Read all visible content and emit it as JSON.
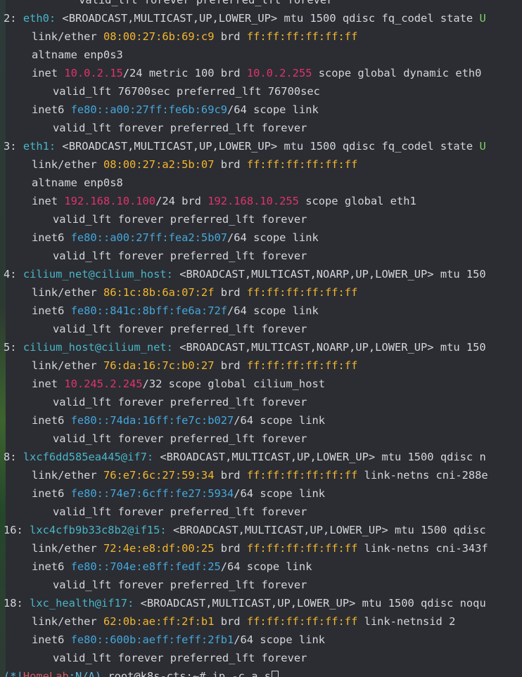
{
  "terminal": {
    "lines": [
      {
        "t": "    valid_lft forever preferred_lft forever"
      },
      {
        "n": "2: ",
        "iface": "eth0:",
        "flags": " <BROADCAST,MULTICAST,UP,LOWER_UP> mtu 1500 qdisc fq_codel state ",
        "tail": "U"
      },
      {
        "a": "link/ether ",
        "mac": "08:00:27:6b:69:c9",
        "b": " brd ",
        "brd": "ff:ff:ff:ff:ff:ff"
      },
      {
        "t": "altname enp0s3"
      },
      {
        "a": "inet ",
        "ip": "10.0.2.15",
        "b": "/24 metric 100 brd ",
        "brd": "10.0.2.255",
        "c": " scope global dynamic eth0"
      },
      {
        "t": "valid_lft 76700sec preferred_lft 76700sec"
      },
      {
        "a": "inet6 ",
        "ip": "fe80::a00:27ff:fe6b:69c9",
        "b": "/64 scope link"
      },
      {
        "t": "valid_lft forever preferred_lft forever"
      },
      {
        "n": "3: ",
        "iface": "eth1:",
        "flags": " <BROADCAST,MULTICAST,UP,LOWER_UP> mtu 1500 qdisc fq_codel state ",
        "tail": "U"
      },
      {
        "a": "link/ether ",
        "mac": "08:00:27:a2:5b:07",
        "b": " brd ",
        "brd": "ff:ff:ff:ff:ff:ff"
      },
      {
        "t": "altname enp0s8"
      },
      {
        "a": "inet ",
        "ip": "192.168.10.100",
        "b": "/24 brd ",
        "brd": "192.168.10.255",
        "c": " scope global eth1"
      },
      {
        "t": "valid_lft forever preferred_lft forever"
      },
      {
        "a": "inet6 ",
        "ip": "fe80::a00:27ff:fea2:5b07",
        "b": "/64 scope link"
      },
      {
        "t": "valid_lft forever preferred_lft forever"
      },
      {
        "n": "4: ",
        "iface": "cilium_net@cilium_host:",
        "flags": " <BROADCAST,MULTICAST,NOARP,UP,LOWER_UP> mtu 150"
      },
      {
        "a": "link/ether ",
        "mac": "86:1c:8b:6a:07:2f",
        "b": " brd ",
        "brd": "ff:ff:ff:ff:ff:ff"
      },
      {
        "a": "inet6 ",
        "ip": "fe80::841c:8bff:fe6a:72f",
        "b": "/64 scope link"
      },
      {
        "t": "valid_lft forever preferred_lft forever"
      },
      {
        "n": "5: ",
        "iface": "cilium_host@cilium_net:",
        "flags": " <BROADCAST,MULTICAST,NOARP,UP,LOWER_UP> mtu 150"
      },
      {
        "a": "link/ether ",
        "mac": "76:da:16:7c:b0:27",
        "b": " brd ",
        "brd": "ff:ff:ff:ff:ff:ff"
      },
      {
        "a": "inet ",
        "ip": "10.245.2.245",
        "b": "/32 scope global cilium_host"
      },
      {
        "t": "valid_lft forever preferred_lft forever"
      },
      {
        "a": "inet6 ",
        "ip": "fe80::74da:16ff:fe7c:b027",
        "b": "/64 scope link"
      },
      {
        "t": "valid_lft forever preferred_lft forever"
      },
      {
        "n": "8: ",
        "iface": "lxcf6dd585ea445@if7:",
        "flags": " <BROADCAST,MULTICAST,UP,LOWER_UP> mtu 1500 qdisc n"
      },
      {
        "a": "link/ether ",
        "mac": "76:e7:6c:27:59:34",
        "b": " brd ",
        "brd": "ff:ff:ff:ff:ff:ff",
        "c": " link-netns cni-288e"
      },
      {
        "a": "inet6 ",
        "ip": "fe80::74e7:6cff:fe27:5934",
        "b": "/64 scope link"
      },
      {
        "t": "valid_lft forever preferred_lft forever"
      },
      {
        "n": "16: ",
        "iface": "lxc4cfb9b33c8b2@if15:",
        "flags": " <BROADCAST,MULTICAST,UP,LOWER_UP> mtu 1500 qdisc"
      },
      {
        "a": "link/ether ",
        "mac": "72:4e:e8:df:00:25",
        "b": " brd ",
        "brd": "ff:ff:ff:ff:ff:ff",
        "c": " link-netns cni-343f"
      },
      {
        "a": "inet6 ",
        "ip": "fe80::704e:e8ff:fedf:25",
        "b": "/64 scope link"
      },
      {
        "t": "valid_lft forever preferred_lft forever"
      },
      {
        "n": "18: ",
        "iface": "lxc_health@if17:",
        "flags": " <BROADCAST,MULTICAST,UP,LOWER_UP> mtu 1500 qdisc noqu"
      },
      {
        "a": "link/ether ",
        "mac": "62:0b:ae:ff:2f:b1",
        "b": " brd ",
        "brd": "ff:ff:ff:ff:ff:ff",
        "c": " link-netnsid 2"
      },
      {
        "a": "inet6 ",
        "ip": "fe80::600b:aeff:feff:2fb1",
        "b": "/64 scope link"
      },
      {
        "t": "valid_lft forever preferred_lft forever"
      }
    ],
    "prompt": {
      "open": "(",
      "star": "*",
      "sep": "|",
      "host": "HomeLab",
      "colon": ":",
      "ns": "N/A",
      "close": ")",
      "rest": " root@k8s-cts:~# ip -c a s"
    }
  },
  "colors": {
    "background": "#2b2d32",
    "text": "#d3d6db",
    "interface": "#49b5c9",
    "mac": "#f5b62e",
    "ipv4": "#e1336b",
    "ipv6": "#45a7dd"
  }
}
